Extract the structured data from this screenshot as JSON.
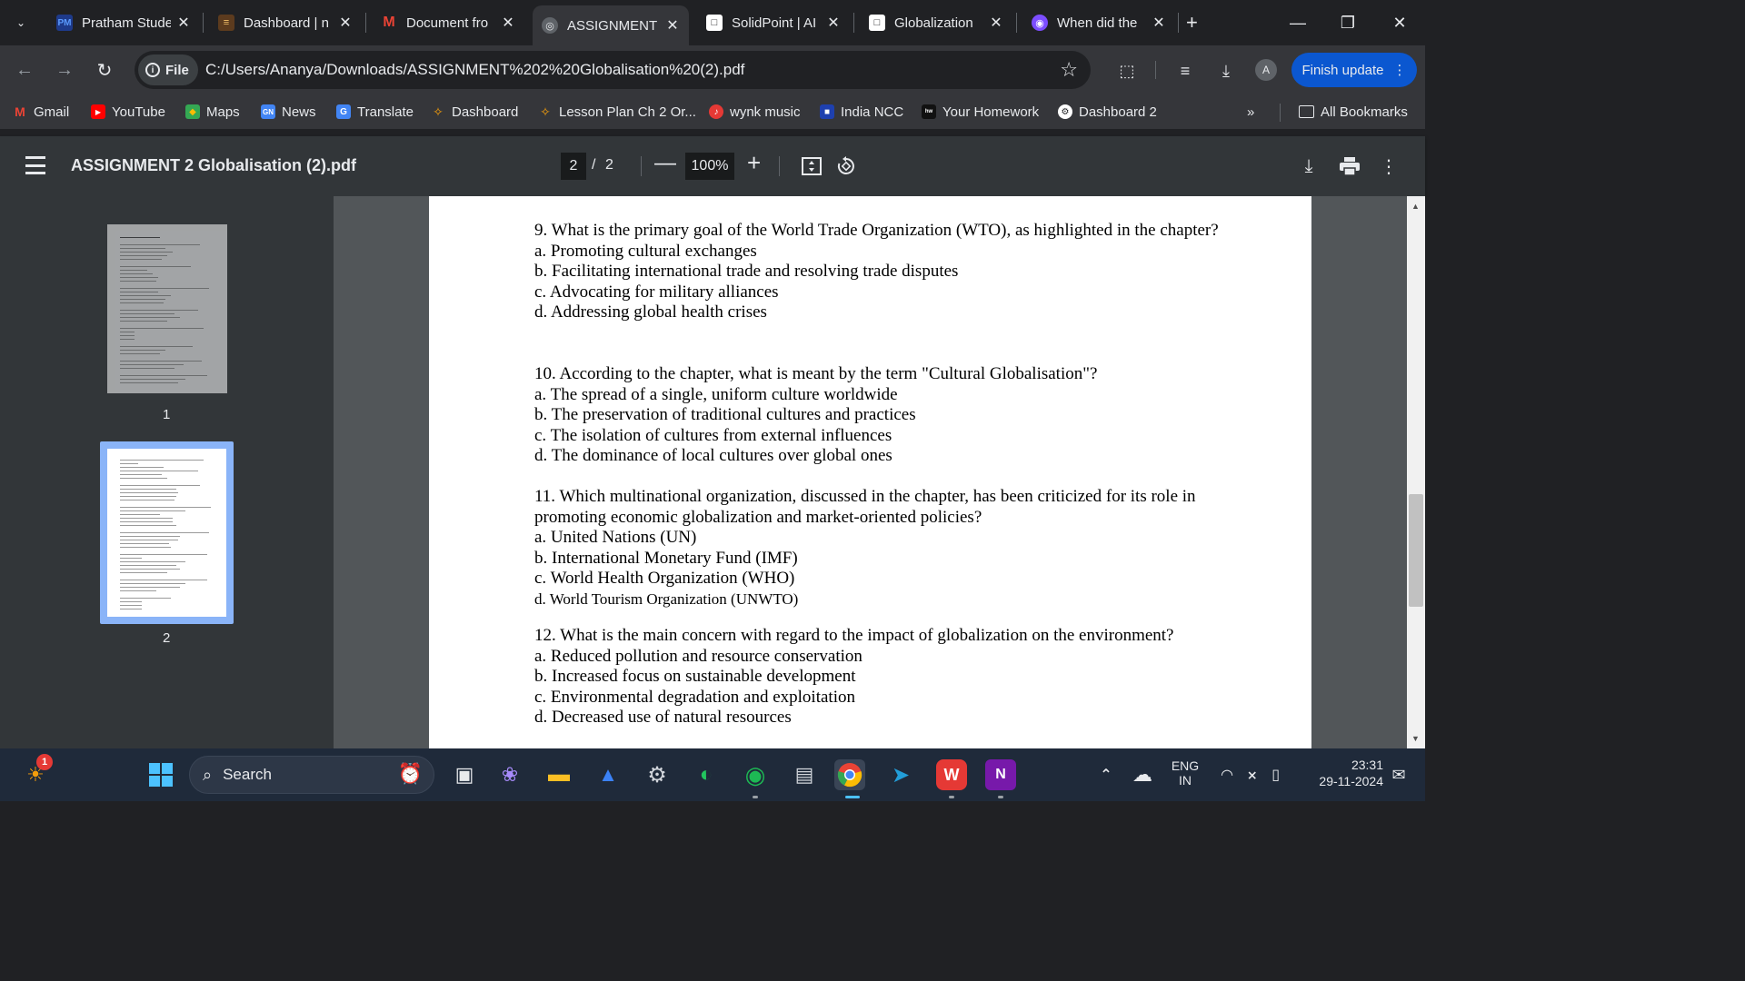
{
  "tabs": [
    {
      "title": "Pratham Stude",
      "favicon": "PM",
      "active": false
    },
    {
      "title": "Dashboard | n",
      "favicon": "books",
      "active": false
    },
    {
      "title": "Document fro",
      "favicon": "M",
      "active": false
    },
    {
      "title": "ASSIGNMENT",
      "favicon": "globe",
      "active": true
    },
    {
      "title": "SolidPoint | AI",
      "favicon": "square",
      "active": false
    },
    {
      "title": "Globalization",
      "favicon": "square",
      "active": false
    },
    {
      "title": "When did the",
      "favicon": "app",
      "active": false
    }
  ],
  "address": {
    "chip_label": "File",
    "url": "C:/Users/Ananya/Downloads/ASSIGNMENT%202%20Globalisation%20(2).pdf"
  },
  "profile": {
    "initial": "A"
  },
  "finish_update_label": "Finish update",
  "bookmarks": [
    {
      "label": "Gmail"
    },
    {
      "label": "YouTube"
    },
    {
      "label": "Maps"
    },
    {
      "label": "News"
    },
    {
      "label": "Translate"
    },
    {
      "label": "Dashboard"
    },
    {
      "label": "Lesson Plan Ch 2 Or..."
    },
    {
      "label": "wynk music"
    },
    {
      "label": "India NCC"
    },
    {
      "label": "Your Homework"
    },
    {
      "label": "Dashboard 2"
    }
  ],
  "bookmarks_more": "»",
  "all_bookmarks_label": "All Bookmarks",
  "pdf": {
    "title": "ASSIGNMENT 2 Globalisation (2).pdf",
    "current_page": "2",
    "page_sep": "/",
    "total_pages": "2",
    "zoom": "100%",
    "thumbnails": [
      {
        "label": "1",
        "selected": false
      },
      {
        "label": "2",
        "selected": true
      }
    ]
  },
  "questions": [
    {
      "text": "9. What is the primary goal of the World Trade Organization (WTO), as highlighted in the chapter?",
      "options": [
        "a. Promoting cultural exchanges",
        "b. Facilitating international trade and resolving trade disputes",
        "c. Advocating for military alliances",
        "d. Addressing global health crises"
      ]
    },
    {
      "text": "10. According to the chapter, what is meant by the term \"Cultural Globalisation\"?",
      "options": [
        "a. The spread of a single, uniform culture worldwide",
        "b. The preservation of traditional cultures and practices",
        "c. The isolation of cultures from external influences",
        "d. The dominance of local cultures over global ones"
      ]
    },
    {
      "text": "11.  Which multinational organization, discussed in the chapter, has been criticized for its role in promoting economic globalization and market-oriented policies?",
      "options": [
        "a. United Nations (UN)",
        "b. International Monetary Fund (IMF)",
        "c. World Health Organization (WHO)",
        "d. World Tourism Organization (UNWTO)"
      ]
    },
    {
      "text": "12.  What is the main concern with regard to the impact of globalization on the environment?",
      "options": [
        "a. Reduced pollution and resource conservation",
        "b. Increased focus on sustainable development",
        "c. Environmental degradation and exploitation",
        "d. Decreased use of natural resources"
      ]
    }
  ],
  "taskbar": {
    "search_label": "Search",
    "weather_badge": "1",
    "language_line1": "ENG",
    "language_line2": "IN",
    "time": "23:31",
    "date": "29-11-2024"
  },
  "colors": {
    "accent": "#0b57d0",
    "tab_bg": "#202124",
    "toolbar_bg": "#35363a",
    "pdf_bar": "#323639",
    "viewer_bg": "#525659",
    "thumb_selected": "#8ab4f8"
  }
}
